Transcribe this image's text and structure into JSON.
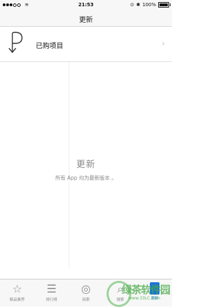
{
  "status_bar": {
    "time": "21:53",
    "battery_percent": "100%",
    "battery_level": 1.0
  },
  "nav": {
    "title": "更新"
  },
  "purchased_row": {
    "label": "已购项目"
  },
  "empty_state": {
    "title": "更新",
    "subtitle": "所有 App 均为最新版本 。"
  },
  "tabs": [
    {
      "label": "精品推荐",
      "icon": "star-icon"
    },
    {
      "label": "排行榜",
      "icon": "list-icon"
    },
    {
      "label": "探索",
      "icon": "compass-icon"
    },
    {
      "label": "搜索",
      "icon": "search-icon"
    },
    {
      "label": "更新",
      "icon": "update-icon",
      "active": true
    }
  ],
  "watermark": {
    "text": "绿茶软件园",
    "url": "www.33LC.com"
  }
}
